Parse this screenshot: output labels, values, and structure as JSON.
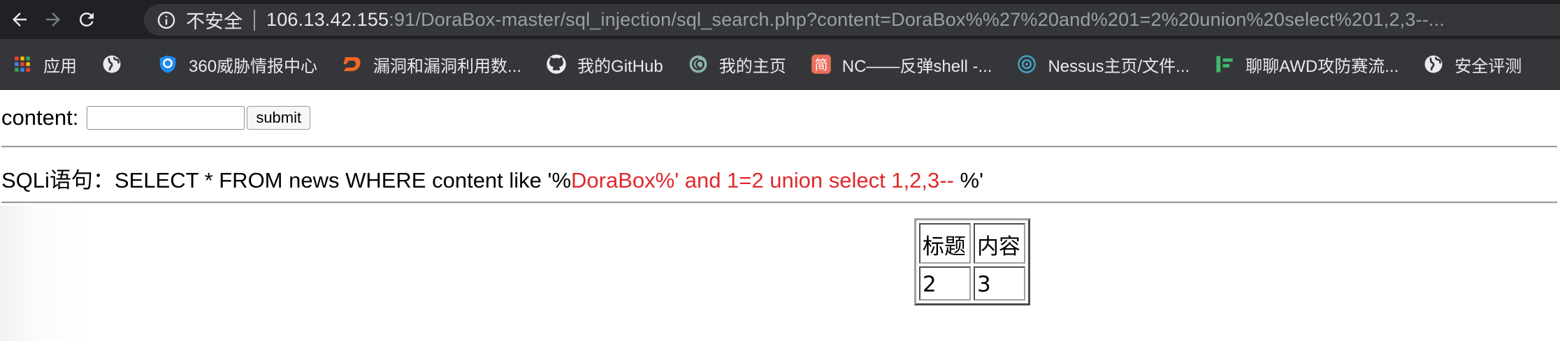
{
  "browser": {
    "security_label": "不安全",
    "url_host": "106.13.42.155",
    "url_rest": ":91/DoraBox-master/sql_injection/sql_search.php?content=DoraBox%%27%20and%201=2%20union%20select%201,2,3--..."
  },
  "bookmarks": [
    {
      "label": "应用",
      "icon": "apps-grid-icon"
    },
    {
      "label": "",
      "icon": "globe-icon"
    },
    {
      "label": "360威胁情报中心",
      "icon": "360-shield-icon"
    },
    {
      "label": "漏洞和漏洞利用数...",
      "icon": "vuln-db-icon"
    },
    {
      "label": "我的GitHub",
      "icon": "github-icon"
    },
    {
      "label": "我的主页",
      "icon": "homepage-swirl-icon"
    },
    {
      "label": "NC——反弹shell -...",
      "icon": "jianshu-icon"
    },
    {
      "label": "Nessus主页/文件...",
      "icon": "nessus-icon"
    },
    {
      "label": "聊聊AWD攻防赛流...",
      "icon": "green-bars-icon"
    },
    {
      "label": "安全评测",
      "icon": "globe-icon"
    }
  ],
  "form": {
    "label": "content:",
    "input_value": "",
    "submit_label": "submit"
  },
  "sql": {
    "prefix": "SQLi语句：SELECT * FROM news WHERE content like '%",
    "injected": "DoraBox%' and 1=2 union select 1,2,3-- ",
    "suffix": "%'"
  },
  "table": {
    "headers": [
      "标题",
      "内容"
    ],
    "rows": [
      [
        "2",
        "3"
      ]
    ]
  },
  "colors": {
    "injection_red": "#e0282b",
    "chrome_dark": "#202124",
    "bookmarks_bar": "#35363a"
  }
}
